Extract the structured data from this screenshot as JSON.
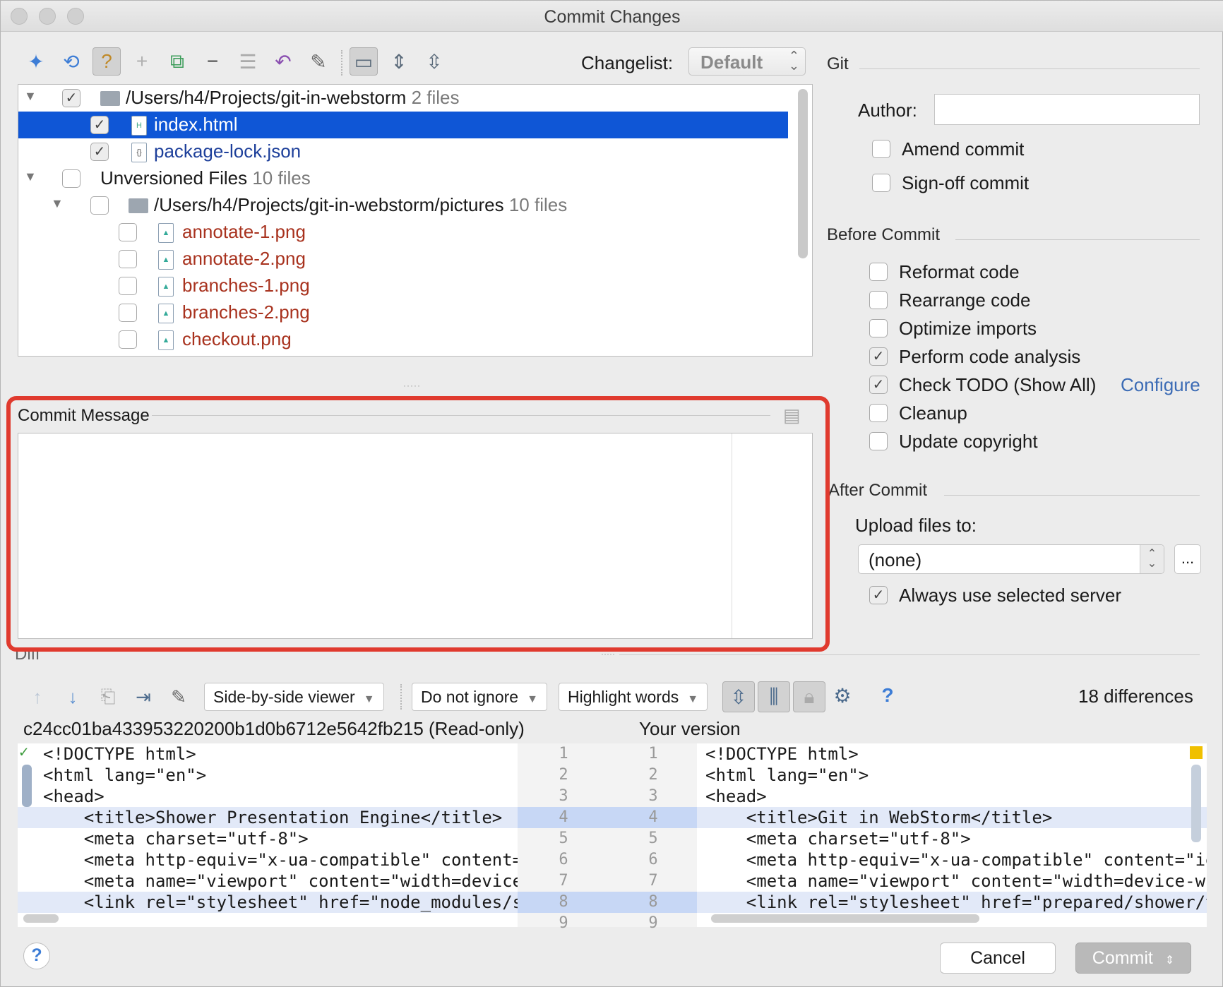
{
  "window": {
    "title": "Commit Changes"
  },
  "toolbar": {
    "changelist_label": "Changelist:",
    "changelist_value": "Default"
  },
  "tree": {
    "rows": [
      {
        "text": "/Users/h4/Projects/git-in-webstorm",
        "count": "2 files"
      },
      {
        "text": "index.html"
      },
      {
        "text": "package-lock.json"
      },
      {
        "text": "Unversioned Files",
        "count": "10 files"
      },
      {
        "text": "/Users/h4/Projects/git-in-webstorm/pictures",
        "count": "10 files"
      },
      {
        "text": "annotate-1.png"
      },
      {
        "text": "annotate-2.png"
      },
      {
        "text": "branches-1.png"
      },
      {
        "text": "branches-2.png"
      },
      {
        "text": "checkout.png"
      }
    ]
  },
  "git": {
    "section": "Git",
    "author_label": "Author:",
    "author_value": "",
    "amend": "Amend commit",
    "signoff": "Sign-off commit"
  },
  "before_commit": {
    "section": "Before Commit",
    "options": [
      "Reformat code",
      "Rearrange code",
      "Optimize imports",
      "Perform code analysis",
      "Check TODO (Show All)",
      "Cleanup",
      "Update copyright"
    ],
    "configure_link": "Configure"
  },
  "after_commit": {
    "section": "After Commit",
    "upload_label": "Upload files to:",
    "upload_value": "(none)",
    "browse": "...",
    "always_use": "Always use selected server"
  },
  "commit_message": {
    "label": "Commit Message",
    "value": ""
  },
  "diff": {
    "section": "Diff",
    "viewer": "Side-by-side viewer",
    "ignore": "Do not ignore",
    "highlight": "Highlight words",
    "differences": "18 differences",
    "left_title": "c24cc01ba433953220200b1d0b6712e5642fb215 (Read-only)",
    "right_title": "Your version",
    "left_lines": [
      "<!DOCTYPE html>",
      "<html lang=\"en\">",
      "<head>",
      "    <title>Shower Presentation Engine</title>",
      "    <meta charset=\"utf-8\">",
      "    <meta http-equiv=\"x-ua-compatible\" content=",
      "    <meta name=\"viewport\" content=\"width=device",
      "    <link rel=\"stylesheet\" href=\"node_modules/s"
    ],
    "right_lines": [
      "<!DOCTYPE html>",
      "<html lang=\"en\">",
      "<head>",
      "    <title>Git in WebStorm</title>",
      "    <meta charset=\"utf-8\">",
      "    <meta http-equiv=\"x-ua-compatible\" content=\"ie=",
      "    <meta name=\"viewport\" content=\"width=device-wi",
      "    <link rel=\"stylesheet\" href=\"prepared/shower/th"
    ],
    "line_numbers": [
      "1",
      "2",
      "3",
      "4",
      "5",
      "6",
      "7",
      "8",
      "9"
    ]
  },
  "buttons": {
    "help": "?",
    "cancel": "Cancel",
    "commit": "Commit"
  },
  "colors": {
    "selection": "#0f56d6",
    "highlight_border": "#e03a2e",
    "unversioned": "#a8321e",
    "link": "#3b6bb5"
  }
}
